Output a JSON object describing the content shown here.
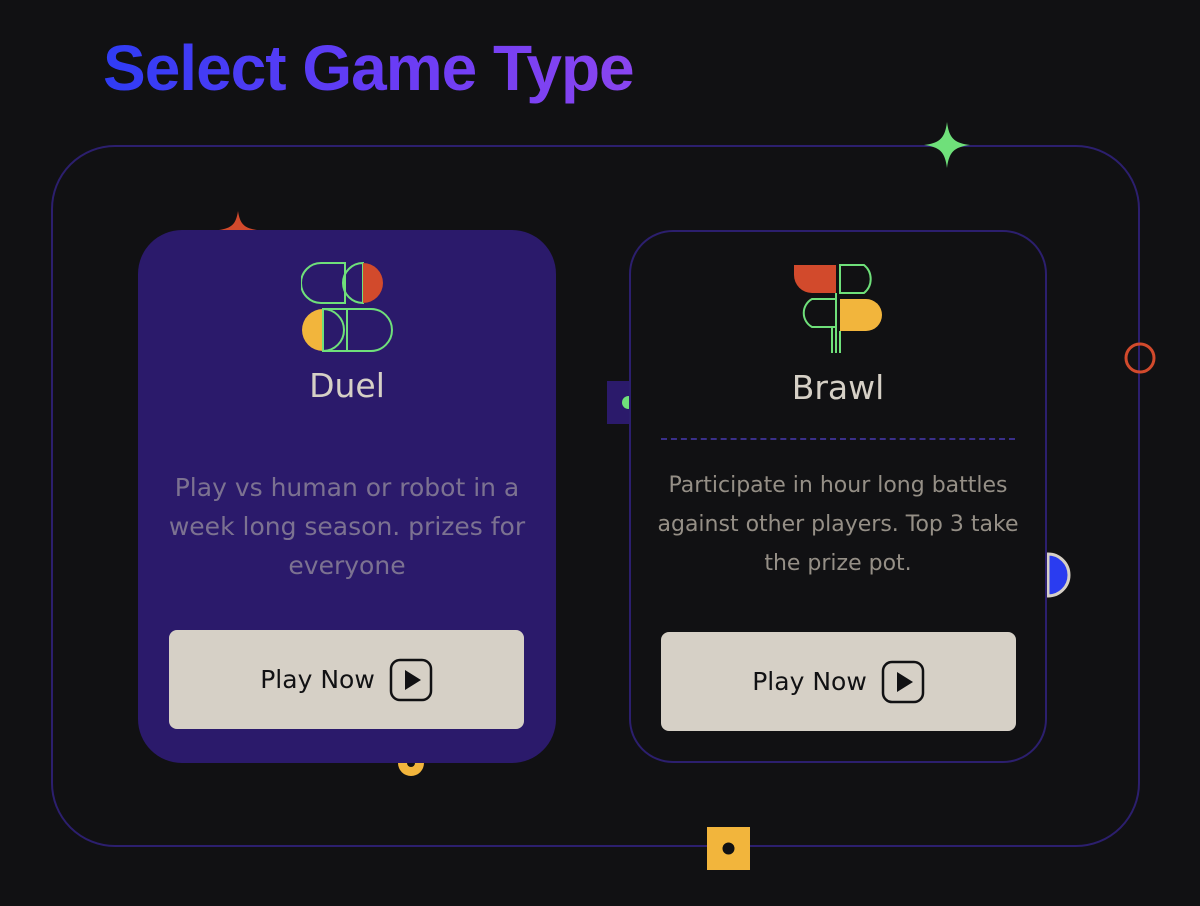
{
  "page": {
    "title": "Select Game Type"
  },
  "cards": [
    {
      "id": "duel",
      "title": "Duel",
      "description": "Play vs human or robot in a week long season. prizes for everyone",
      "button_label": "Play Now",
      "icon": "duel-logo-icon"
    },
    {
      "id": "brawl",
      "title": "Brawl",
      "description": "Participate in hour long battles against other players. Top 3 take the prize pot.",
      "button_label": "Play Now",
      "icon": "brawl-logo-icon"
    }
  ],
  "colors": {
    "background": "#111113",
    "duel_card": "#2b1a6b",
    "frame_border": "#2c1f6e",
    "button": "#d6d0c6",
    "accent_red": "#d24a2c",
    "accent_yellow": "#f2b53c",
    "accent_green": "#6fe07a",
    "accent_blue": "#2a3cf0"
  }
}
